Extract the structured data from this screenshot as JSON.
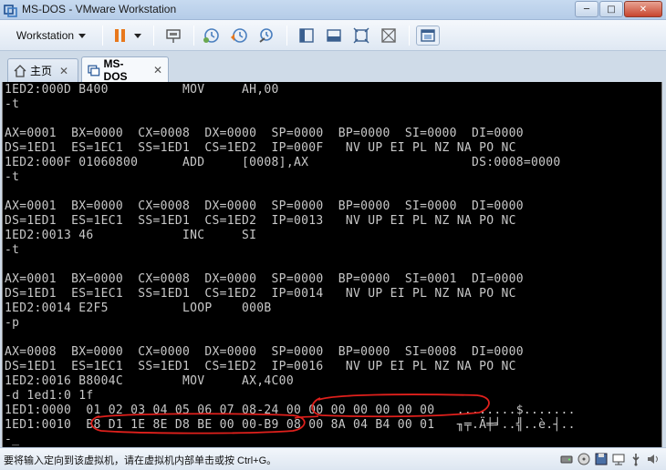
{
  "window": {
    "title": "MS-DOS - VMware Workstation",
    "minimize_glyph": "─",
    "maximize_glyph": "□",
    "close_glyph": "✕"
  },
  "toolbar": {
    "workstation_label": "Workstation",
    "icons": [
      "pause-icon",
      "send-keys-icon",
      "snapshot-icon",
      "revert-snapshot-icon",
      "snapshot-manager-icon",
      "console-view-icon",
      "quick-switch-icon",
      "full-screen-icon",
      "unity-icon",
      "library-icon"
    ]
  },
  "tabs": [
    {
      "label": "主页",
      "close": "✕"
    },
    {
      "label": "MS-DOS",
      "close": "✕"
    }
  ],
  "console": {
    "lines": [
      "1ED2:000D B400          MOV     AH,00",
      "-t",
      "",
      "AX=0001  BX=0000  CX=0008  DX=0000  SP=0000  BP=0000  SI=0000  DI=0000",
      "DS=1ED1  ES=1EC1  SS=1ED1  CS=1ED2  IP=000F   NV UP EI PL NZ NA PO NC",
      "1ED2:000F 01060800      ADD     [0008],AX                      DS:0008=0000",
      "-t",
      "",
      "AX=0001  BX=0000  CX=0008  DX=0000  SP=0000  BP=0000  SI=0000  DI=0000",
      "DS=1ED1  ES=1EC1  SS=1ED1  CS=1ED2  IP=0013   NV UP EI PL NZ NA PO NC",
      "1ED2:0013 46            INC     SI",
      "-t",
      "",
      "AX=0001  BX=0000  CX=0008  DX=0000  SP=0000  BP=0000  SI=0001  DI=0000",
      "DS=1ED1  ES=1EC1  SS=1ED1  CS=1ED2  IP=0014   NV UP EI PL NZ NA PO NC",
      "1ED2:0014 E2F5          LOOP    000B",
      "-p",
      "",
      "AX=0008  BX=0000  CX=0000  DX=0000  SP=0000  BP=0000  SI=0008  DI=0000",
      "DS=1ED1  ES=1EC1  SS=1ED1  CS=1ED2  IP=0016   NV UP EI PL NZ NA PO NC",
      "1ED2:0016 B8004C        MOV     AX,4C00",
      "-d 1ed1:0 1f",
      "1ED1:0000  01 02 03 04 05 06 07 08-24 00 00 00 00 00 00 00   ........$.......",
      "1ED1:0010  B8 D1 1E 8E D8 BE 00 00-B9 08 00 8A 04 B4 00 01   ╖╤.Ä╪╛..╣..è.┤..",
      "-_"
    ]
  },
  "status": {
    "text": "要将输入定向到该虚拟机，请在虚拟机内部单击或按 Ctrl+G。",
    "icons": [
      "hard-disk-icon",
      "cd-drive-icon",
      "floppy-icon",
      "network-icon",
      "usb-icon",
      "sound-icon"
    ]
  },
  "colors": {
    "console_bg": "#000000",
    "console_fg": "#c8c8c8",
    "annotation": "#e0201c",
    "pause_accent": "#e8781c"
  }
}
